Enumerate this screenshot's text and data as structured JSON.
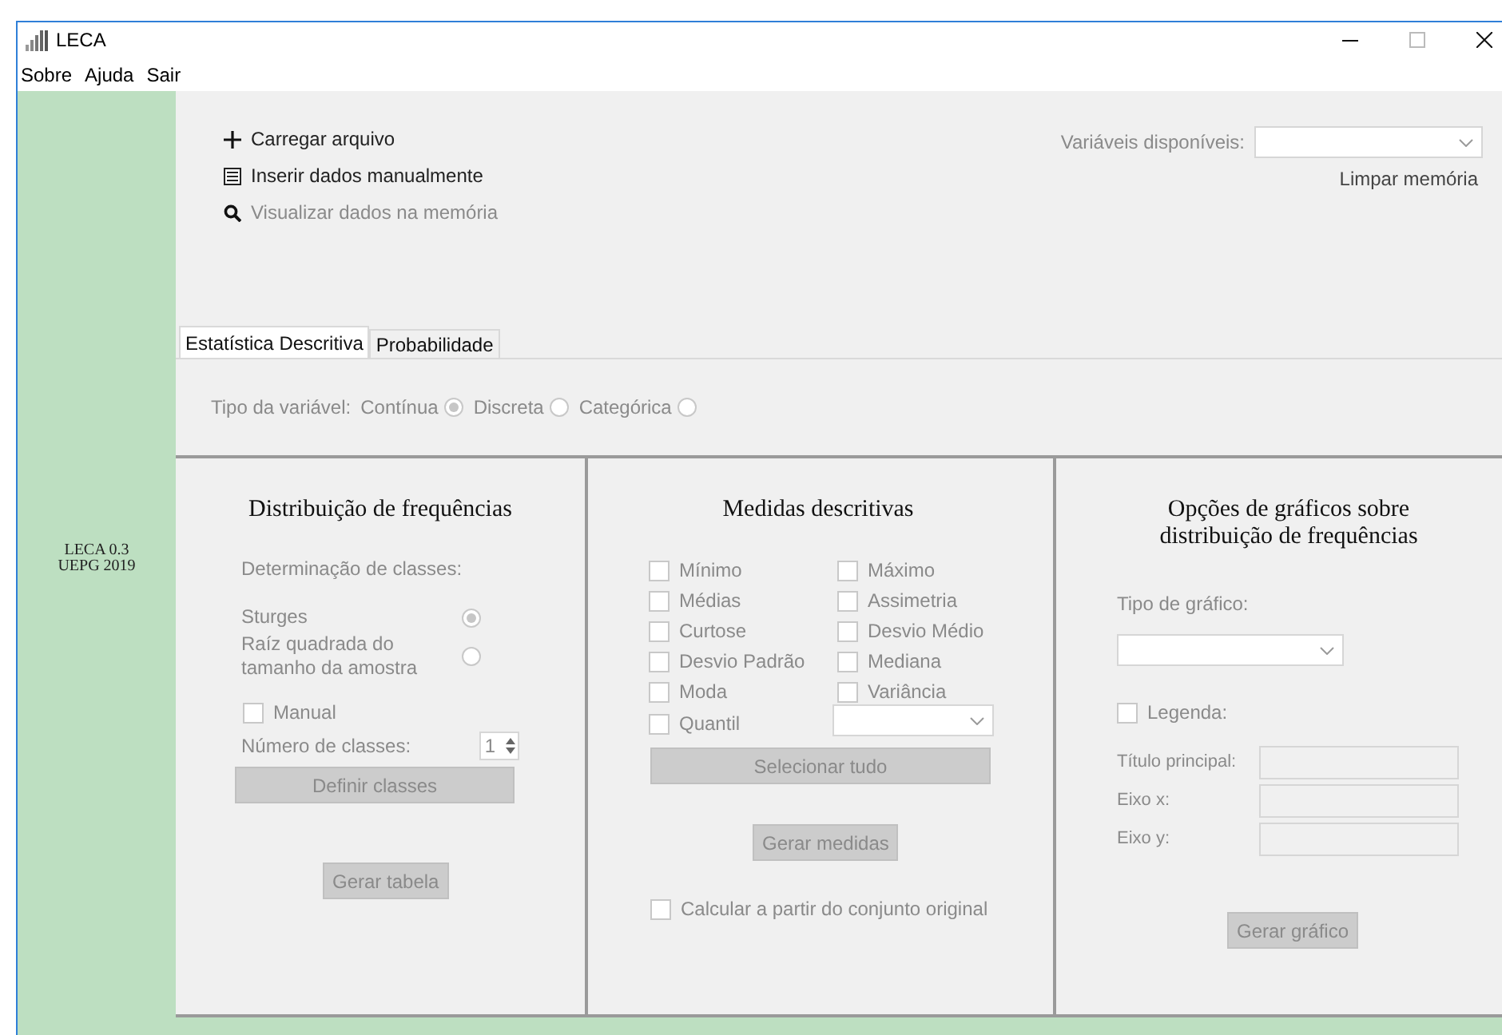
{
  "window": {
    "title": "LECA"
  },
  "menu": [
    "Sobre",
    "Ajuda",
    "Sair"
  ],
  "sidebar": {
    "version": "LECA 0.3",
    "org": "UEPG 2019"
  },
  "actions": [
    {
      "kind": "add",
      "label": "Carregar arquivo",
      "disabled": false
    },
    {
      "kind": "table",
      "label": "Inserir dados manualmente",
      "disabled": false
    },
    {
      "kind": "search",
      "label": "Visualizar dados na memória",
      "disabled": true
    }
  ],
  "variables": {
    "label": "Variáveis disponíveis:"
  },
  "clear_memory": "Limpar memória",
  "tabs": [
    {
      "label": "Estatística Descritiva",
      "selected": true
    },
    {
      "label": "Probabilidade",
      "selected": false
    }
  ],
  "variable_type": {
    "label": "Tipo da variável:",
    "options": [
      {
        "label": "Contínua",
        "selected": true
      },
      {
        "label": "Discreta",
        "selected": false
      },
      {
        "label": "Categórica",
        "selected": false
      }
    ]
  },
  "frequency": {
    "title": "Distribuição de frequências",
    "classes_label": "Determinação de classes:",
    "methods": [
      {
        "label": "Sturges",
        "selected": true
      },
      {
        "label": "Raíz quadrada do tamanho da amostra",
        "selected": false
      }
    ],
    "manual": {
      "label": "Manual",
      "checked": false
    },
    "class_count": {
      "label": "Número de classes:",
      "value": "1"
    },
    "define_button": "Definir classes",
    "table_button": "Gerar tabela"
  },
  "measures": {
    "title": "Medidas descritivas",
    "items": [
      {
        "kind": "checkbox",
        "label": "Mínimo",
        "checked": false
      },
      {
        "kind": "checkbox",
        "label": "Máximo",
        "checked": false
      },
      {
        "kind": "checkbox",
        "label": "Médias",
        "checked": false
      },
      {
        "kind": "checkbox",
        "label": "Assimetria",
        "checked": false
      },
      {
        "kind": "checkbox",
        "label": "Curtose",
        "checked": false
      },
      {
        "kind": "checkbox",
        "label": "Desvio Médio",
        "checked": false
      },
      {
        "kind": "checkbox",
        "label": "Desvio Padrão",
        "checked": false
      },
      {
        "kind": "checkbox",
        "label": "Mediana",
        "checked": false
      },
      {
        "kind": "checkbox",
        "label": "Moda",
        "checked": false
      },
      {
        "kind": "checkbox",
        "label": "Variância",
        "checked": false
      },
      {
        "kind": "checkbox",
        "label": "Quantil",
        "checked": false
      },
      {
        "kind": "select"
      }
    ],
    "select_all": "Selecionar tudo",
    "generate": "Gerar medidas",
    "original": {
      "label": "Calcular a partir do conjunto original",
      "checked": false
    }
  },
  "charts": {
    "title": "Opções de gráficos sobre distribuição de frequências",
    "type_label": "Tipo de gráfico:",
    "legend": {
      "label": "Legenda:",
      "checked": false
    },
    "fields": [
      {
        "label": "Título principal:"
      },
      {
        "label": "Eixo x:"
      },
      {
        "label": "Eixo y:"
      }
    ],
    "button": "Gerar gráfico"
  }
}
